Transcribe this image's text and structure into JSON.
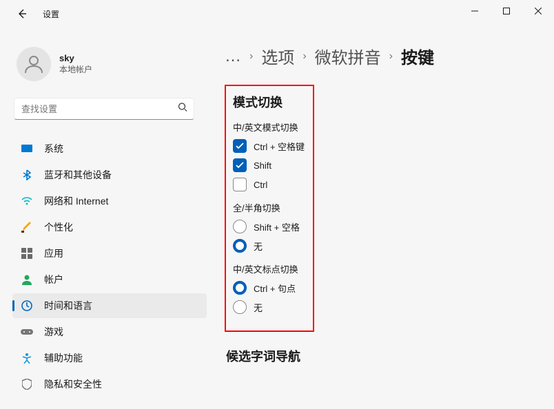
{
  "title": "设置",
  "user": {
    "name": "sky",
    "sub": "本地帐户"
  },
  "search": {
    "placeholder": "查找设置"
  },
  "nav": {
    "items": [
      {
        "label": "系统"
      },
      {
        "label": "蓝牙和其他设备"
      },
      {
        "label": "网络和 Internet"
      },
      {
        "label": "个性化"
      },
      {
        "label": "应用"
      },
      {
        "label": "帐户"
      },
      {
        "label": "时间和语言"
      },
      {
        "label": "游戏"
      },
      {
        "label": "辅助功能"
      },
      {
        "label": "隐私和安全性"
      }
    ]
  },
  "breadcrumb": {
    "ellipsis": "…",
    "items": [
      "选项",
      "微软拼音",
      "按键"
    ]
  },
  "content": {
    "mode_switch_heading": "模式切换",
    "cn_en_mode_heading": "中/英文模式切换",
    "cn_en_mode_opts": {
      "ctrl_space": "Ctrl + 空格键",
      "shift": "Shift",
      "ctrl": "Ctrl"
    },
    "full_half_heading": "全/半角切换",
    "full_half_opts": {
      "shift_space": "Shift + 空格",
      "none": "无"
    },
    "punct_heading": "中/英文标点切换",
    "punct_opts": {
      "ctrl_period": "Ctrl + 句点",
      "none": "无"
    },
    "candidate_nav_heading": "候选字词导航"
  }
}
